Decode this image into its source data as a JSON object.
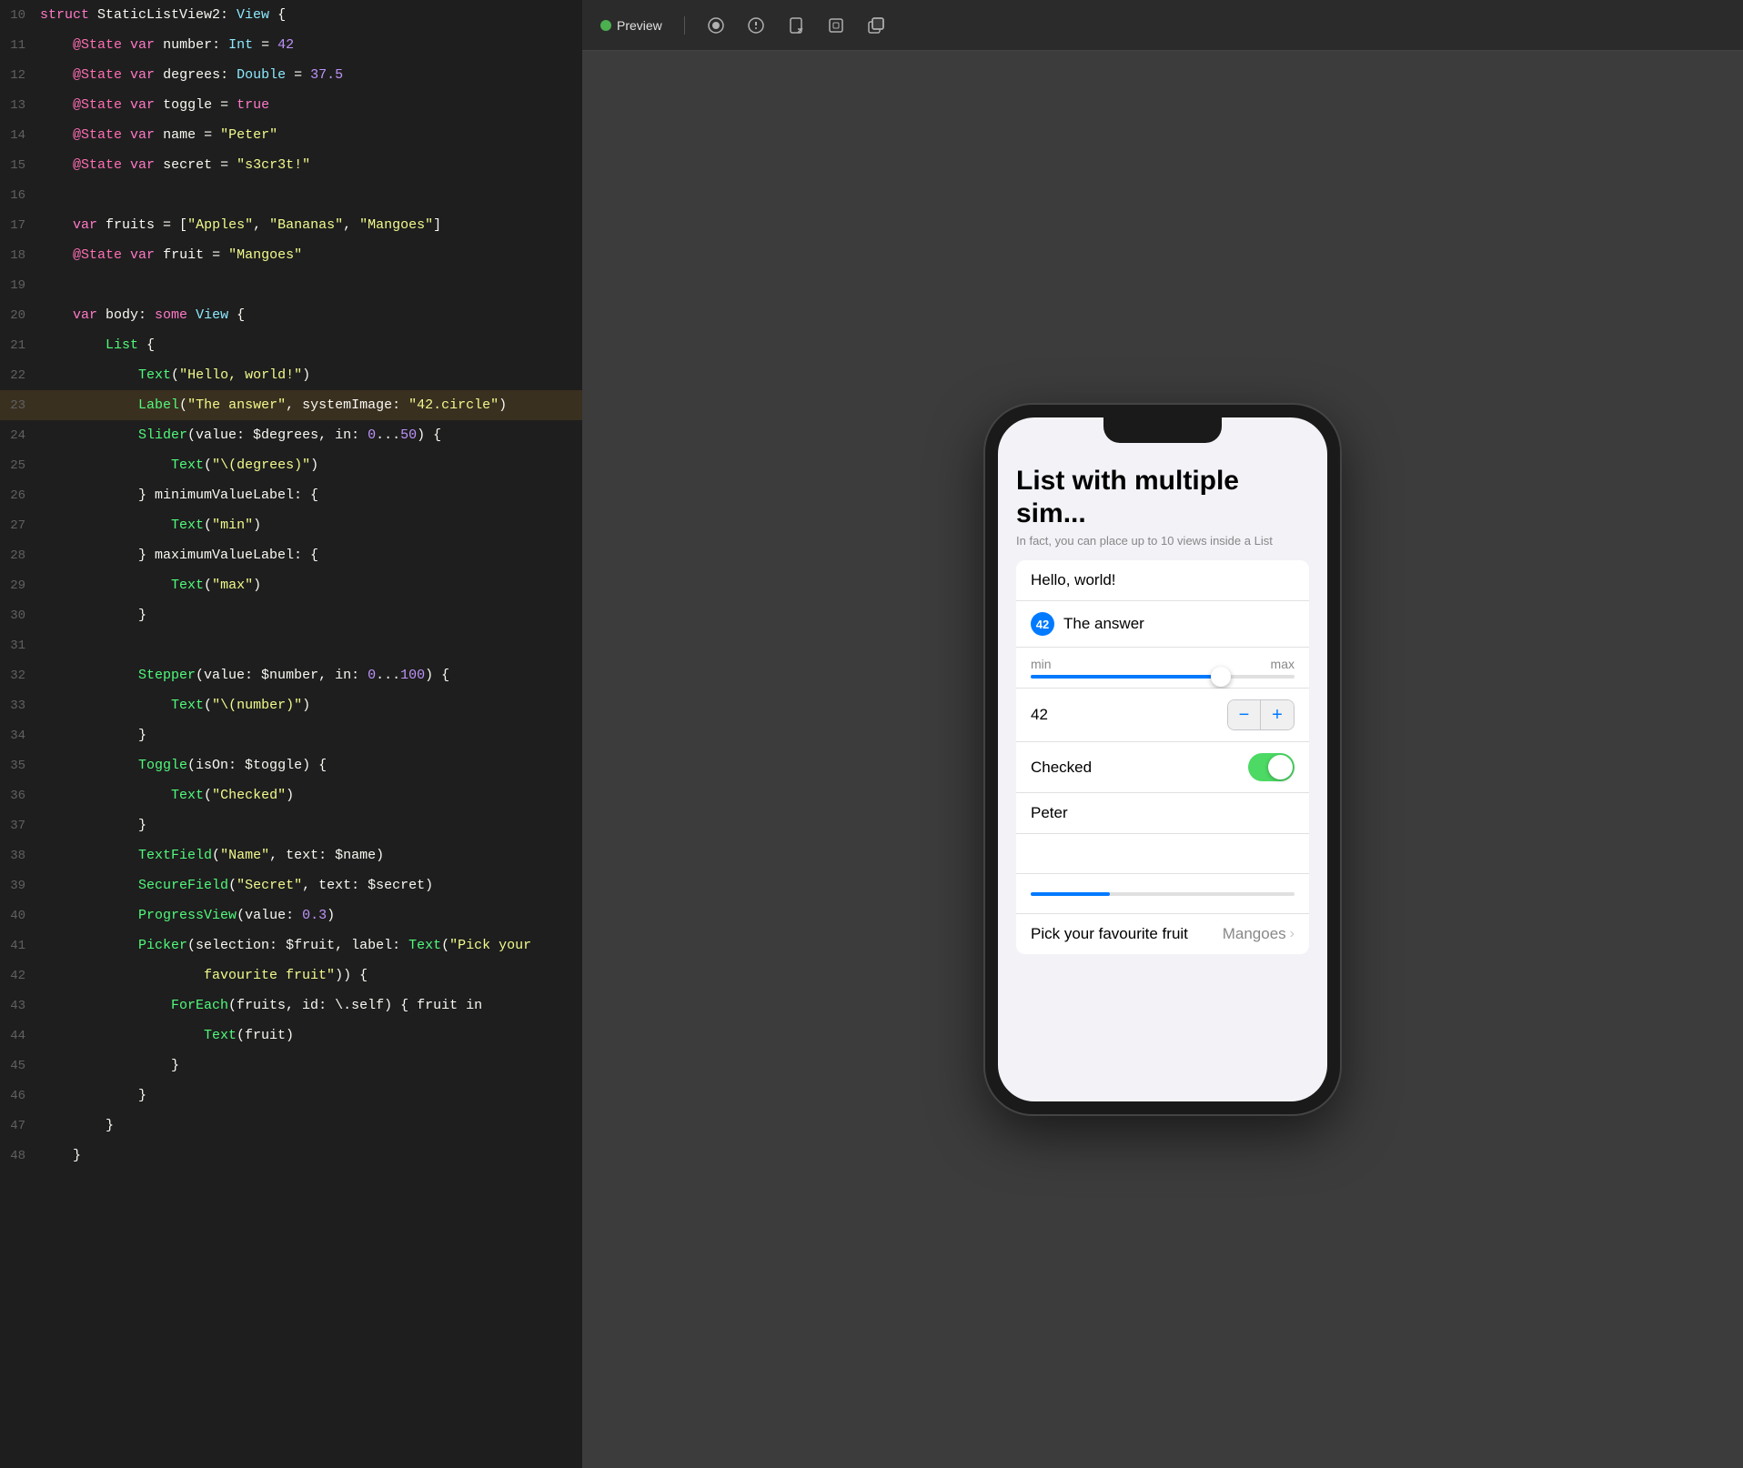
{
  "editor": {
    "lines": [
      {
        "num": 10,
        "tokens": [
          {
            "t": "kw",
            "v": "struct"
          },
          {
            "t": "plain",
            "v": " StaticListView2: "
          },
          {
            "t": "type",
            "v": "View"
          },
          {
            "t": "plain",
            "v": " {"
          }
        ]
      },
      {
        "num": 11,
        "tokens": [
          {
            "t": "plain",
            "v": "    "
          },
          {
            "t": "kw2",
            "v": "@State"
          },
          {
            "t": "plain",
            "v": " "
          },
          {
            "t": "kw",
            "v": "var"
          },
          {
            "t": "plain",
            "v": " number: "
          },
          {
            "t": "type",
            "v": "Int"
          },
          {
            "t": "plain",
            "v": " = "
          },
          {
            "t": "num",
            "v": "42"
          }
        ]
      },
      {
        "num": 12,
        "tokens": [
          {
            "t": "plain",
            "v": "    "
          },
          {
            "t": "kw2",
            "v": "@State"
          },
          {
            "t": "plain",
            "v": " "
          },
          {
            "t": "kw",
            "v": "var"
          },
          {
            "t": "plain",
            "v": " degrees: "
          },
          {
            "t": "type",
            "v": "Double"
          },
          {
            "t": "plain",
            "v": " = "
          },
          {
            "t": "num",
            "v": "37.5"
          }
        ]
      },
      {
        "num": 13,
        "tokens": [
          {
            "t": "plain",
            "v": "    "
          },
          {
            "t": "kw2",
            "v": "@State"
          },
          {
            "t": "plain",
            "v": " "
          },
          {
            "t": "kw",
            "v": "var"
          },
          {
            "t": "plain",
            "v": " toggle = "
          },
          {
            "t": "kw",
            "v": "true"
          }
        ]
      },
      {
        "num": 14,
        "tokens": [
          {
            "t": "plain",
            "v": "    "
          },
          {
            "t": "kw2",
            "v": "@State"
          },
          {
            "t": "plain",
            "v": " "
          },
          {
            "t": "kw",
            "v": "var"
          },
          {
            "t": "plain",
            "v": " name = "
          },
          {
            "t": "str",
            "v": "\"Peter\""
          }
        ]
      },
      {
        "num": 15,
        "tokens": [
          {
            "t": "plain",
            "v": "    "
          },
          {
            "t": "kw2",
            "v": "@State"
          },
          {
            "t": "plain",
            "v": " "
          },
          {
            "t": "kw",
            "v": "var"
          },
          {
            "t": "plain",
            "v": " secret = "
          },
          {
            "t": "str",
            "v": "\"s3cr3t!\""
          }
        ]
      },
      {
        "num": 16,
        "tokens": [
          {
            "t": "plain",
            "v": "    "
          }
        ]
      },
      {
        "num": 17,
        "tokens": [
          {
            "t": "plain",
            "v": "    "
          },
          {
            "t": "kw",
            "v": "var"
          },
          {
            "t": "plain",
            "v": " fruits = ["
          },
          {
            "t": "str",
            "v": "\"Apples\""
          },
          {
            "t": "plain",
            "v": ", "
          },
          {
            "t": "str",
            "v": "\"Bananas\""
          },
          {
            "t": "plain",
            "v": ", "
          },
          {
            "t": "str",
            "v": "\"Mangoes\""
          },
          {
            "t": "plain",
            "v": "]"
          }
        ]
      },
      {
        "num": 18,
        "tokens": [
          {
            "t": "plain",
            "v": "    "
          },
          {
            "t": "kw2",
            "v": "@State"
          },
          {
            "t": "plain",
            "v": " "
          },
          {
            "t": "kw",
            "v": "var"
          },
          {
            "t": "plain",
            "v": " fruit = "
          },
          {
            "t": "str",
            "v": "\"Mangoes\""
          }
        ]
      },
      {
        "num": 19,
        "tokens": [
          {
            "t": "plain",
            "v": "    "
          }
        ]
      },
      {
        "num": 20,
        "tokens": [
          {
            "t": "plain",
            "v": "    "
          },
          {
            "t": "kw",
            "v": "var"
          },
          {
            "t": "plain",
            "v": " body: "
          },
          {
            "t": "kw",
            "v": "some"
          },
          {
            "t": "plain",
            "v": " "
          },
          {
            "t": "type",
            "v": "View"
          },
          {
            "t": "plain",
            "v": " {"
          }
        ]
      },
      {
        "num": 21,
        "tokens": [
          {
            "t": "plain",
            "v": "        "
          },
          {
            "t": "fn",
            "v": "List"
          },
          {
            "t": "plain",
            "v": " {"
          }
        ]
      },
      {
        "num": 22,
        "tokens": [
          {
            "t": "plain",
            "v": "            "
          },
          {
            "t": "fn",
            "v": "Text"
          },
          {
            "t": "plain",
            "v": "("
          },
          {
            "t": "str",
            "v": "\"Hello, world!\""
          },
          {
            "t": "plain",
            "v": ")"
          }
        ]
      },
      {
        "num": 23,
        "highlighted": true,
        "tokens": [
          {
            "t": "plain",
            "v": "            "
          },
          {
            "t": "fn",
            "v": "Label"
          },
          {
            "t": "plain",
            "v": "("
          },
          {
            "t": "str",
            "v": "\"The answer\""
          },
          {
            "t": "plain",
            "v": ", systemImage: "
          },
          {
            "t": "str",
            "v": "\"42.circle\""
          },
          {
            "t": "plain",
            "v": ")"
          }
        ]
      },
      {
        "num": 24,
        "tokens": [
          {
            "t": "plain",
            "v": "            "
          },
          {
            "t": "fn",
            "v": "Slider"
          },
          {
            "t": "plain",
            "v": "(value: $degrees, in: "
          },
          {
            "t": "num",
            "v": "0"
          },
          {
            "t": "plain",
            "v": "..."
          },
          {
            "t": "num",
            "v": "50"
          },
          {
            "t": "plain",
            "v": ") {"
          }
        ]
      },
      {
        "num": 25,
        "tokens": [
          {
            "t": "plain",
            "v": "                "
          },
          {
            "t": "fn",
            "v": "Text"
          },
          {
            "t": "plain",
            "v": "("
          },
          {
            "t": "str",
            "v": "\"\\(degrees)\""
          },
          {
            "t": "plain",
            "v": ")"
          }
        ]
      },
      {
        "num": 26,
        "tokens": [
          {
            "t": "plain",
            "v": "            } minimumValueLabel: {"
          }
        ]
      },
      {
        "num": 27,
        "tokens": [
          {
            "t": "plain",
            "v": "                "
          },
          {
            "t": "fn",
            "v": "Text"
          },
          {
            "t": "plain",
            "v": "("
          },
          {
            "t": "str",
            "v": "\"min\""
          },
          {
            "t": "plain",
            "v": ")"
          }
        ]
      },
      {
        "num": 28,
        "tokens": [
          {
            "t": "plain",
            "v": "            } maximumValueLabel: {"
          }
        ]
      },
      {
        "num": 29,
        "tokens": [
          {
            "t": "plain",
            "v": "                "
          },
          {
            "t": "fn",
            "v": "Text"
          },
          {
            "t": "plain",
            "v": "("
          },
          {
            "t": "str",
            "v": "\"max\""
          },
          {
            "t": "plain",
            "v": ")"
          }
        ]
      },
      {
        "num": 30,
        "tokens": [
          {
            "t": "plain",
            "v": "            }"
          }
        ]
      },
      {
        "num": 31,
        "tokens": [
          {
            "t": "plain",
            "v": "        "
          }
        ]
      },
      {
        "num": 32,
        "tokens": [
          {
            "t": "plain",
            "v": "            "
          },
          {
            "t": "fn",
            "v": "Stepper"
          },
          {
            "t": "plain",
            "v": "(value: $number, in: "
          },
          {
            "t": "num",
            "v": "0"
          },
          {
            "t": "plain",
            "v": "..."
          },
          {
            "t": "num",
            "v": "100"
          },
          {
            "t": "plain",
            "v": ") {"
          }
        ]
      },
      {
        "num": 33,
        "tokens": [
          {
            "t": "plain",
            "v": "                "
          },
          {
            "t": "fn",
            "v": "Text"
          },
          {
            "t": "plain",
            "v": "("
          },
          {
            "t": "str",
            "v": "\"\\(number)\""
          },
          {
            "t": "plain",
            "v": ")"
          }
        ]
      },
      {
        "num": 34,
        "tokens": [
          {
            "t": "plain",
            "v": "            }"
          }
        ]
      },
      {
        "num": 35,
        "tokens": [
          {
            "t": "plain",
            "v": "            "
          },
          {
            "t": "fn",
            "v": "Toggle"
          },
          {
            "t": "plain",
            "v": "(isOn: $toggle) {"
          }
        ]
      },
      {
        "num": 36,
        "tokens": [
          {
            "t": "plain",
            "v": "                "
          },
          {
            "t": "fn",
            "v": "Text"
          },
          {
            "t": "plain",
            "v": "("
          },
          {
            "t": "str",
            "v": "\"Checked\""
          },
          {
            "t": "plain",
            "v": ")"
          }
        ]
      },
      {
        "num": 37,
        "tokens": [
          {
            "t": "plain",
            "v": "            }"
          }
        ]
      },
      {
        "num": 38,
        "tokens": [
          {
            "t": "plain",
            "v": "            "
          },
          {
            "t": "fn",
            "v": "TextField"
          },
          {
            "t": "plain",
            "v": "("
          },
          {
            "t": "str",
            "v": "\"Name\""
          },
          {
            "t": "plain",
            "v": ", text: $name)"
          }
        ]
      },
      {
        "num": 39,
        "tokens": [
          {
            "t": "plain",
            "v": "            "
          },
          {
            "t": "fn",
            "v": "SecureField"
          },
          {
            "t": "plain",
            "v": "("
          },
          {
            "t": "str",
            "v": "\"Secret\""
          },
          {
            "t": "plain",
            "v": ", text: $secret)"
          }
        ]
      },
      {
        "num": 40,
        "tokens": [
          {
            "t": "plain",
            "v": "            "
          },
          {
            "t": "fn",
            "v": "ProgressView"
          },
          {
            "t": "plain",
            "v": "(value: "
          },
          {
            "t": "num",
            "v": "0.3"
          },
          {
            "t": "plain",
            "v": ")"
          }
        ]
      },
      {
        "num": 41,
        "tokens": [
          {
            "t": "plain",
            "v": "            "
          },
          {
            "t": "fn",
            "v": "Picker"
          },
          {
            "t": "plain",
            "v": "(selection: $fruit, label: "
          },
          {
            "t": "fn",
            "v": "Text"
          },
          {
            "t": "plain",
            "v": "("
          },
          {
            "t": "str",
            "v": "\"Pick your"
          },
          {
            "t": "plain",
            "v": ""
          }
        ]
      },
      {
        "num": 42,
        "tokens": [
          {
            "t": "plain",
            "v": "                    "
          },
          {
            "t": "str",
            "v": "favourite fruit\""
          },
          {
            "t": "plain",
            "v": ")) {"
          }
        ]
      },
      {
        "num": 43,
        "tokens": [
          {
            "t": "plain",
            "v": "                "
          },
          {
            "t": "fn",
            "v": "ForEach"
          },
          {
            "t": "plain",
            "v": "(fruits, id: \\.self) { fruit in"
          }
        ]
      },
      {
        "num": 44,
        "tokens": [
          {
            "t": "plain",
            "v": "                    "
          },
          {
            "t": "fn",
            "v": "Text"
          },
          {
            "t": "plain",
            "v": "(fruit)"
          }
        ]
      },
      {
        "num": 45,
        "tokens": [
          {
            "t": "plain",
            "v": "                }"
          }
        ]
      },
      {
        "num": 46,
        "tokens": [
          {
            "t": "plain",
            "v": "            }"
          }
        ]
      },
      {
        "num": 47,
        "tokens": [
          {
            "t": "plain",
            "v": "        }"
          }
        ]
      },
      {
        "num": 48,
        "tokens": [
          {
            "t": "plain",
            "v": "    }"
          }
        ]
      }
    ]
  },
  "toolbar": {
    "preview_label": "Preview",
    "icons": [
      "record",
      "inspect",
      "rotate",
      "device",
      "duplicate"
    ]
  },
  "phone": {
    "title": "List with multiple sim...",
    "subtitle": "In fact, you can place up to 10 views inside a List",
    "rows": {
      "hello": "Hello, world!",
      "answer_badge": "42",
      "answer_label": "The answer",
      "slider_min": "min",
      "slider_max": "max",
      "stepper_value": "42",
      "checked_label": "Checked",
      "name_value": "Peter",
      "picker_label": "Pick your favourite fruit",
      "picker_value": "Mangoes"
    }
  }
}
